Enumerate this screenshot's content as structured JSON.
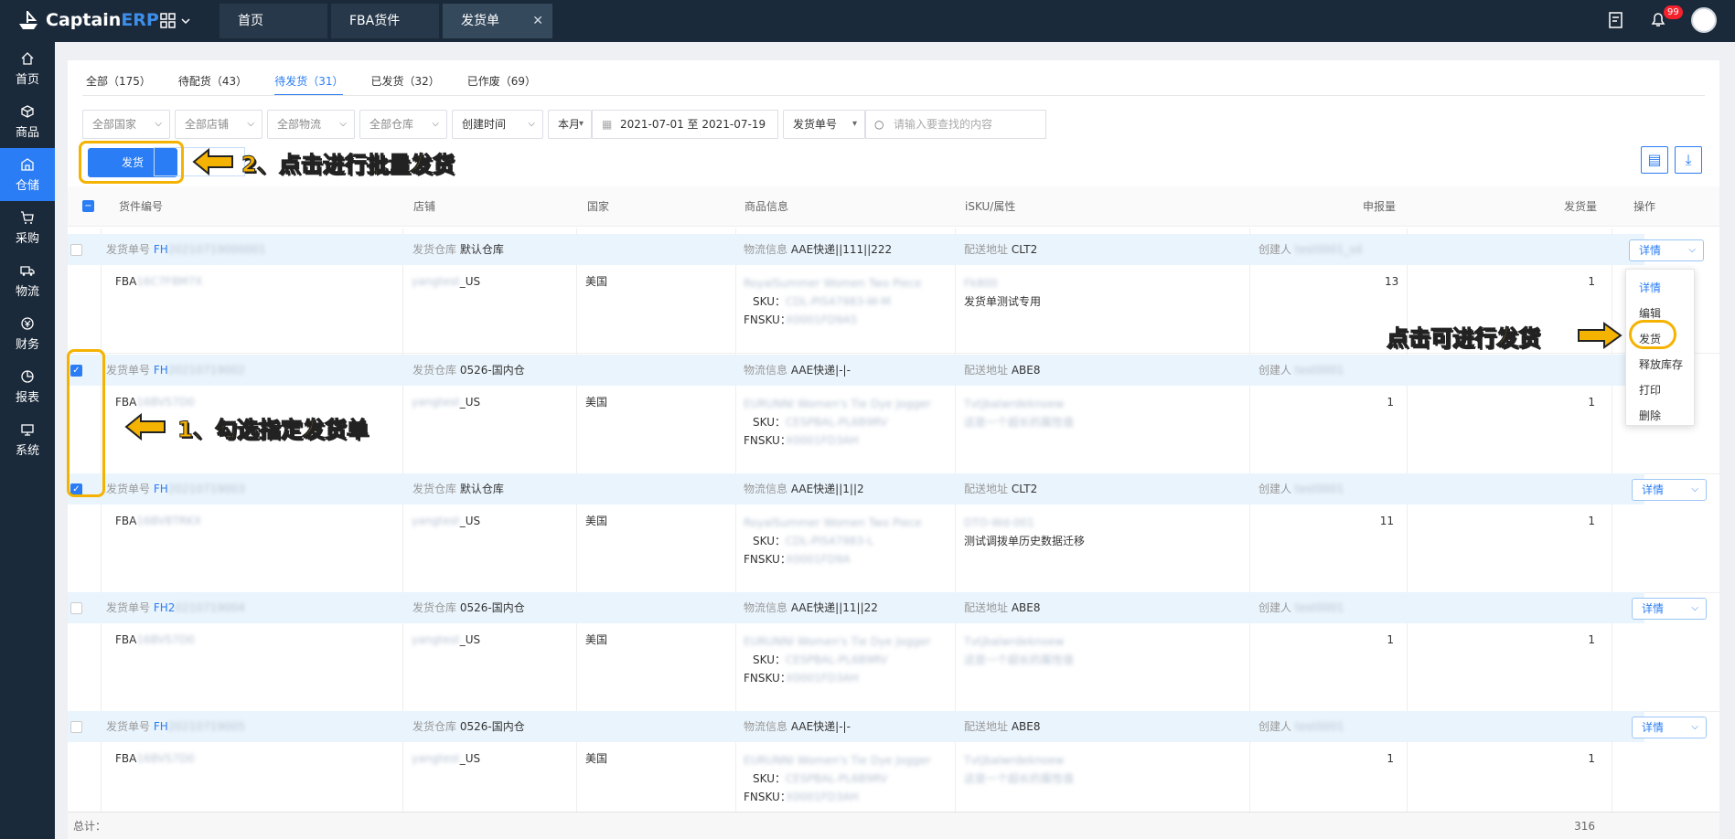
{
  "app": {
    "name_prefix": "Captain",
    "name_suffix": "ERP"
  },
  "nav_tabs": [
    {
      "label": "首页"
    },
    {
      "label": "FBA货件"
    },
    {
      "label": "发货单"
    }
  ],
  "badge_count": "99",
  "sidebar": {
    "items": [
      {
        "label": "首页",
        "icon": "home-icon"
      },
      {
        "label": "商品",
        "icon": "box-icon"
      },
      {
        "label": "仓储",
        "icon": "warehouse-icon"
      },
      {
        "label": "采购",
        "icon": "cart-icon"
      },
      {
        "label": "物流",
        "icon": "truck-icon"
      },
      {
        "label": "财务",
        "icon": "money-icon"
      },
      {
        "label": "报表",
        "icon": "chart-icon"
      },
      {
        "label": "系统",
        "icon": "system-icon"
      }
    ]
  },
  "status_tabs": [
    "全部（175）",
    "待配货（43）",
    "待发货（31）",
    "已发货（32）",
    "已作废（69）"
  ],
  "filters": {
    "country": "全部国家",
    "shop": "全部店铺",
    "logistics": "全部物流",
    "warehouse": "全部仓库",
    "time_type": "创建时间",
    "period": "本月",
    "date_range": "2021-07-01 至 2021-07-19",
    "field": "发货单号",
    "search_placeholder": "请输入要查找的内容"
  },
  "ship_button": "发货",
  "annotations": {
    "a1": "1、勾选指定发货单",
    "a2": "2、点击进行批量发货",
    "a3": "点击可进行发货"
  },
  "columns": [
    "货件编号",
    "店铺",
    "国家",
    "商品信息",
    "iSKU/属性",
    "申报量",
    "发货量",
    "操作"
  ],
  "labels": {
    "order_no": "发货单号",
    "warehouse": "发货仓库",
    "logistics": "物流信息",
    "address": "配送地址",
    "creator": "创建人",
    "sku": "SKU：",
    "fnsku": "FNSKU：",
    "detail": "详情",
    "total": "总计："
  },
  "rows": [
    {
      "order_prefix": "FH",
      "order_blur": "20210719000001",
      "warehouse": "默认仓库",
      "logistics": "AAE快递||111||222",
      "address": "CLT2",
      "creator_blur": "test0001_sd",
      "fba": "FBA",
      "fba_blur": "16C7F8M7X",
      "shop_blur": "yangtest",
      "shop_suffix": "_US",
      "country": "美国",
      "product_blur": "RoyalSummer Women Two Piece",
      "sku_blur": "CDL-PIS47983-W-M",
      "fnsku_blur": "X0001FD9A5",
      "isku_blur": "Fk800",
      "attr": "发货单测试专用",
      "attr_blur": "",
      "declared": "13",
      "shipped": "1",
      "checked": false
    },
    {
      "order_prefix": "FH",
      "order_blur": "20210719002",
      "warehouse": "0526-国内仓",
      "logistics": "AAE快递|-|-",
      "address": "ABE8",
      "creator_blur": "test0001",
      "fba": "FBA",
      "fba_blur": "16BVS7D0",
      "shop_blur": "yangtest",
      "shop_suffix": "_US",
      "country": "美国",
      "product_blur": "EURUNNI Women's Tie Dye Jogger",
      "sku_blur": "CESPBAL-PL6B9RV",
      "fnsku_blur": "X0001FD3AH",
      "isku_blur": "Tvtjbalwrdeknoew",
      "attr": "",
      "attr_blur": "这是一个超长的属性值",
      "declared": "1",
      "shipped": "1",
      "checked": true
    },
    {
      "order_prefix": "FH",
      "order_blur": "20210719003",
      "warehouse": "默认仓库",
      "logistics": "AAE快递||1||2",
      "address": "CLT2",
      "creator_blur": "test0001",
      "fba": "FBA",
      "fba_blur": "16BV8TRKX",
      "shop_blur": "yangtest",
      "shop_suffix": "_US",
      "country": "美国",
      "product_blur": "RoyalSummer Women Two Piece",
      "sku_blur": "CDL-PIS47983-L",
      "fnsku_blur": "X0001FD9A",
      "isku_blur": "DTO-Wd-001",
      "attr": "测试调拨单历史数据迁移",
      "attr_blur": "",
      "declared": "11",
      "shipped": "1",
      "checked": true
    },
    {
      "order_prefix": "FH2",
      "order_blur": "0210719004",
      "warehouse": "0526-国内仓",
      "logistics": "AAE快递||11||22",
      "address": "ABE8",
      "creator_blur": "test0001",
      "fba": "FBA",
      "fba_blur": "16BVS7D0",
      "shop_blur": "yangtest",
      "shop_suffix": "_US",
      "country": "美国",
      "product_blur": "EURUNNI Women's Tie Dye Jogger",
      "sku_blur": "CESPBAL-PL6B9RV",
      "fnsku_blur": "X0001FD3AH",
      "isku_blur": "Tvtjbalwrdeknoew",
      "attr": "",
      "attr_blur": "这是一个超长的属性值",
      "declared": "1",
      "shipped": "1",
      "checked": false
    },
    {
      "order_prefix": "FH",
      "order_blur": "20210719005",
      "warehouse": "0526-国内仓",
      "logistics": "AAE快递|-|-",
      "address": "ABE8",
      "creator_blur": "test0001",
      "fba": "FBA",
      "fba_blur": "16BVS7D0",
      "shop_blur": "yangtest",
      "shop_suffix": "_US",
      "country": "美国",
      "product_blur": "EURUNNI Women's Tie Dye Jogger",
      "sku_blur": "CESPBAL-PL6B9RV",
      "fnsku_blur": "X0001FD3AH",
      "isku_blur": "Tvtjbalwrdeknoew",
      "attr": "",
      "attr_blur": "这是一个超长的属性值",
      "declared": "1",
      "shipped": "1",
      "checked": false
    }
  ],
  "dropdown_menu": [
    "详情",
    "编辑",
    "发货",
    "释放库存",
    "打印",
    "删除"
  ],
  "total_shipped": "316",
  "colors": {
    "accent": "#2a7df4",
    "sidebar": "#1b2a3a",
    "highlight": "#f5b301"
  }
}
